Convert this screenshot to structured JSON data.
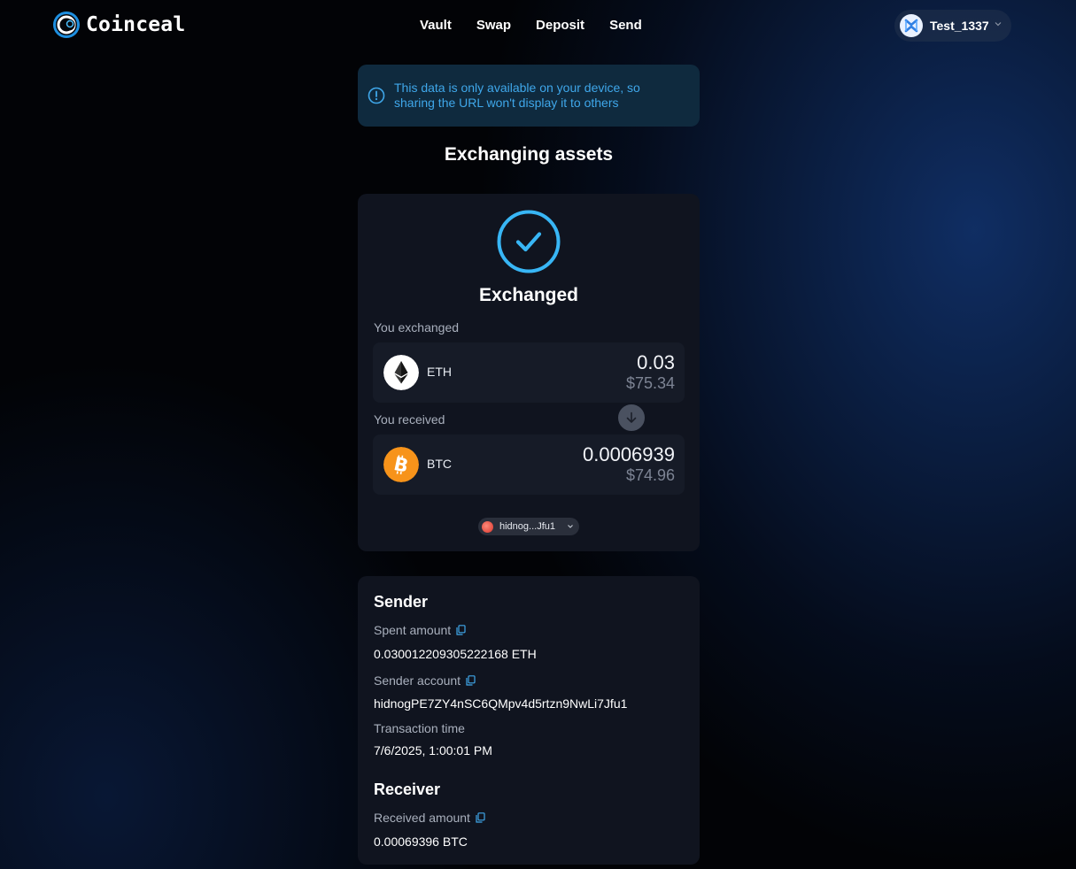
{
  "header": {
    "logo_text": "Coinceal",
    "nav": [
      "Vault",
      "Swap",
      "Deposit",
      "Send"
    ],
    "user_name": "Test_1337"
  },
  "banner": {
    "text": "This data is only available on your device, so sharing the URL won't display it to others",
    "icon": "info-icon",
    "color": "#3fa7ea"
  },
  "page_title": "Exchanging assets",
  "exchange": {
    "status": "Exchanged",
    "status_icon": "check-circle-icon",
    "accent": "#38b6f5",
    "exchanged_label": "You exchanged",
    "from": {
      "symbol": "ETH",
      "amount": "0.03",
      "usd": "$75.34",
      "icon": "ethereum-icon"
    },
    "received_label": "You received",
    "to": {
      "symbol": "BTC",
      "amount": "0.0006939",
      "usd": "$74.96",
      "icon": "bitcoin-icon",
      "color": "#f7931a"
    },
    "account_short": "hidnog...Jfu1"
  },
  "details": {
    "sender_title": "Sender",
    "spent_label": "Spent amount",
    "spent_value": "0.030012209305222168 ETH",
    "sender_account_label": "Sender account",
    "sender_account_value": "hidnogPE7ZY4nSC6QMpv4d5rtzn9NwLi7Jfu1",
    "time_label": "Transaction time",
    "time_value": "7/6/2025, 1:00:01 PM",
    "receiver_title": "Receiver",
    "received_label": "Received amount",
    "received_value": "0.00069396 BTC"
  }
}
